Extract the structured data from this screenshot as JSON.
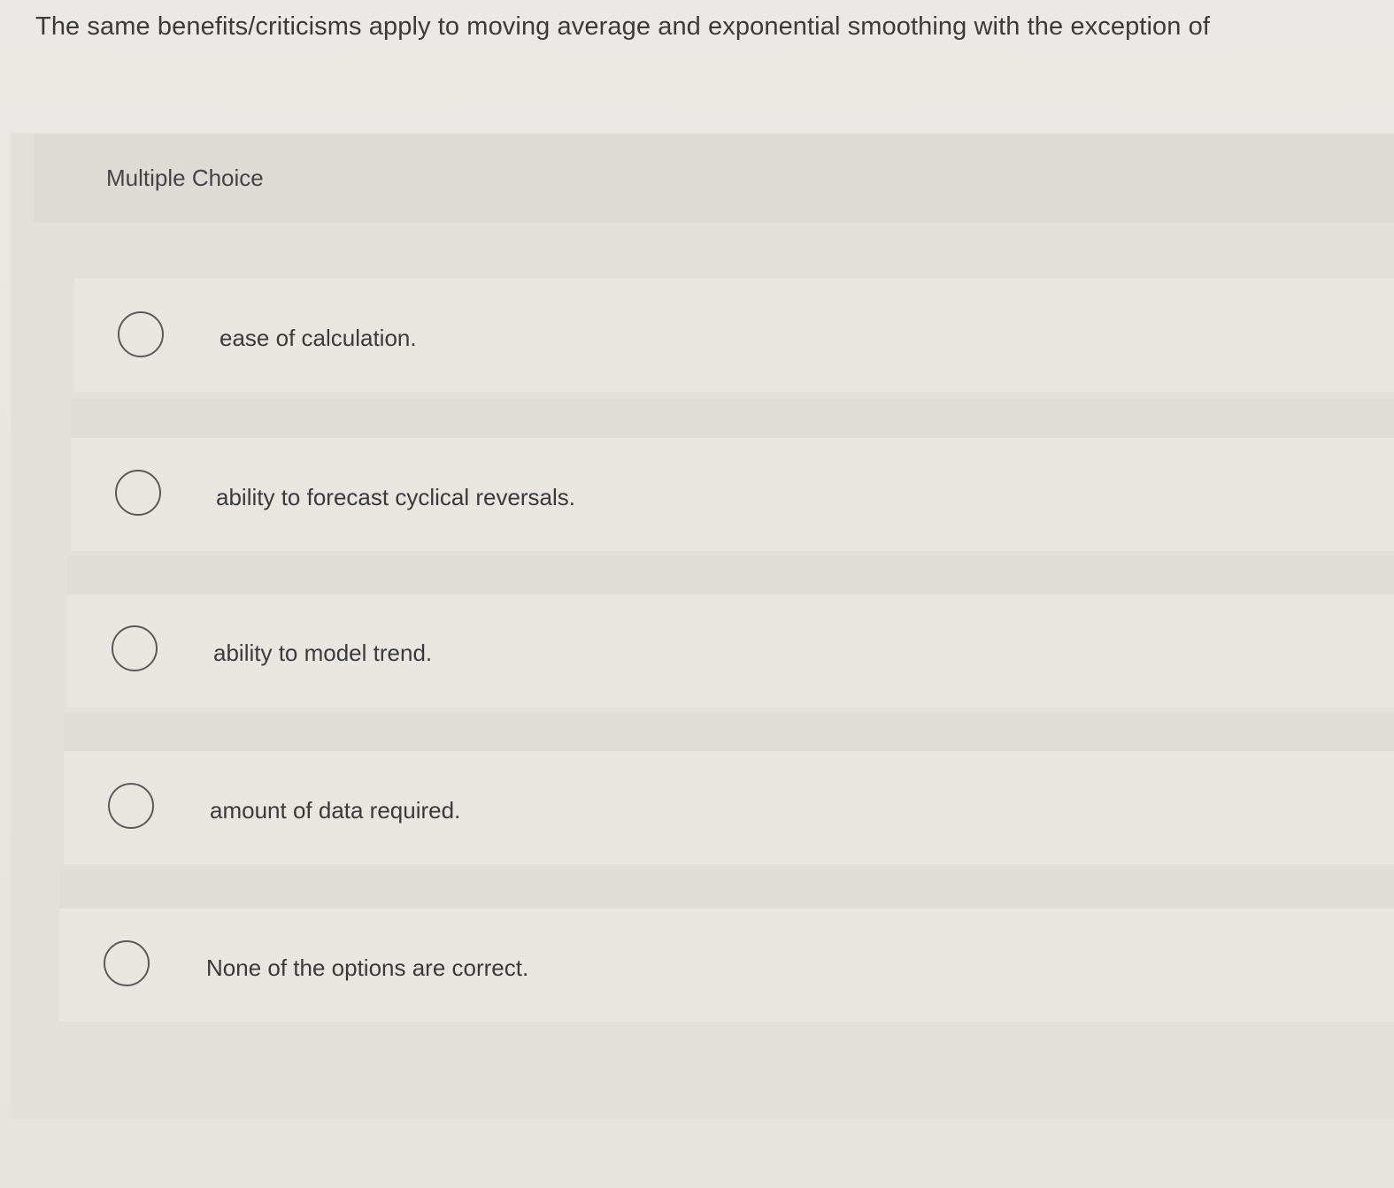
{
  "question": {
    "text": "The same benefits/criticisms apply to moving average and exponential smoothing with the exception of"
  },
  "panel": {
    "header_label": "Multiple Choice"
  },
  "options": [
    {
      "label": "ease of calculation.",
      "selected": false
    },
    {
      "label": "ability to forecast cyclical reversals.",
      "selected": false
    },
    {
      "label": "ability to model trend.",
      "selected": false
    },
    {
      "label": "amount of data required.",
      "selected": false
    },
    {
      "label": "None of the options are correct.",
      "selected": false
    }
  ]
}
